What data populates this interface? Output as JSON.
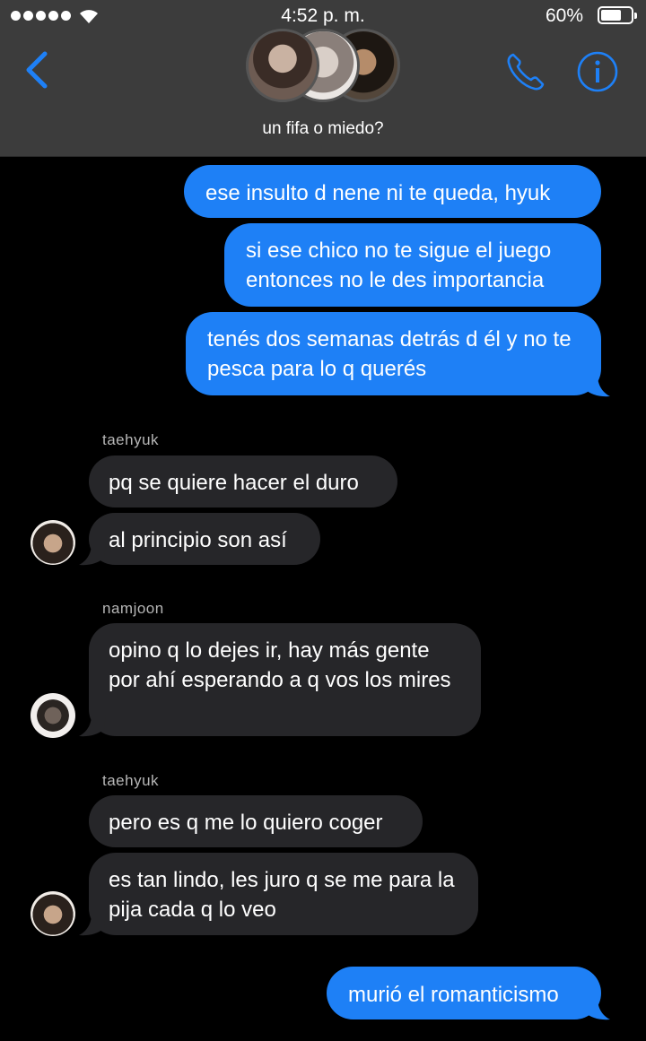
{
  "status_bar": {
    "time": "4:52 p. m.",
    "battery": "60%",
    "battery_level": 0.6
  },
  "header": {
    "title": "un fifa o miedo?",
    "back_icon": "chevron-left-icon",
    "call_icon": "phone-icon",
    "info_icon": "info-icon",
    "accent": "#1e80f6"
  },
  "messages": [
    {
      "dir": "out",
      "text": "ese insulto d nene ni te queda, hyuk"
    },
    {
      "dir": "out",
      "text": "si ese chico no te sigue el juego entonces no le des importancia"
    },
    {
      "dir": "out",
      "text": "tenés dos semanas detrás d él y no te pesca para lo q querés"
    },
    {
      "dir": "in",
      "sender": "taehyuk",
      "text": "pq se quiere hacer el duro"
    },
    {
      "dir": "in",
      "text": "al principio son así"
    },
    {
      "dir": "in",
      "sender": "namjoon",
      "text": "opino q lo dejes ir, hay más gente por ahí esperando a q vos los mires"
    },
    {
      "dir": "in",
      "sender": "taehyuk",
      "text": "pero es q me lo quiero coger"
    },
    {
      "dir": "in",
      "text": "es tan lindo, les juro q se me para la pija cada q lo veo"
    },
    {
      "dir": "out",
      "text": "murió el romanticismo"
    }
  ],
  "colors": {
    "outgoing": "#1e80f6",
    "incoming": "#262629",
    "header": "#3c3c3c",
    "background": "#000000"
  }
}
